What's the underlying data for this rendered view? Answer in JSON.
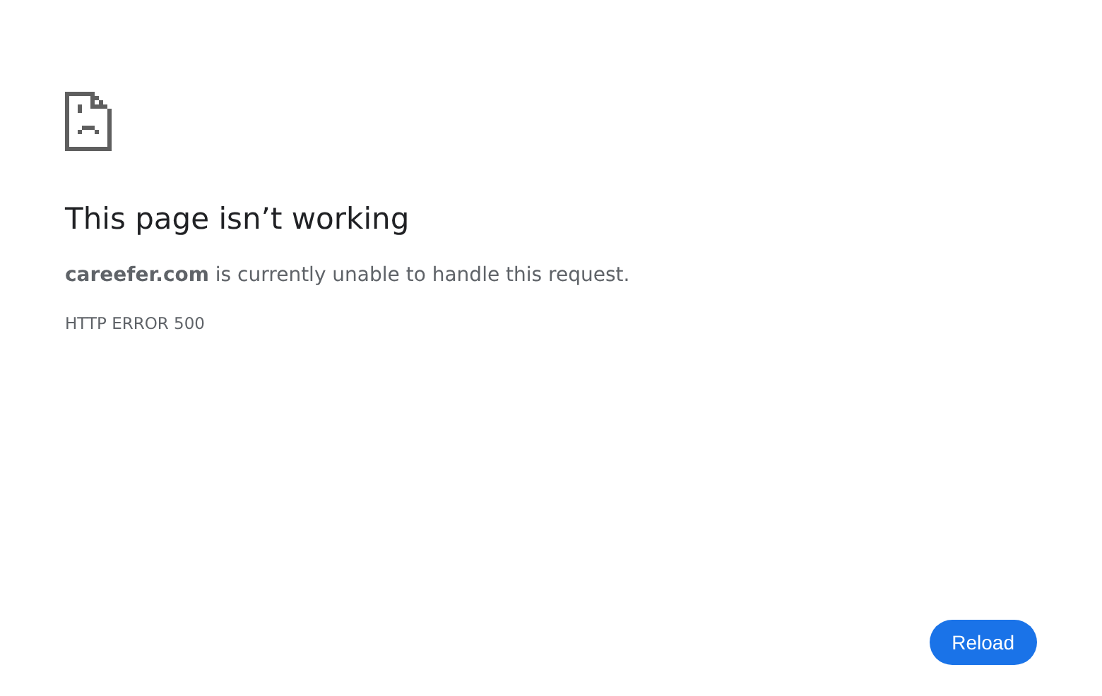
{
  "title": "This page isn’t working",
  "message": "**careefer.com** is currently unable to handle this request.",
  "error_code": "HTTP ERROR 500",
  "buttons": [
    "Reload"
  ]
}
